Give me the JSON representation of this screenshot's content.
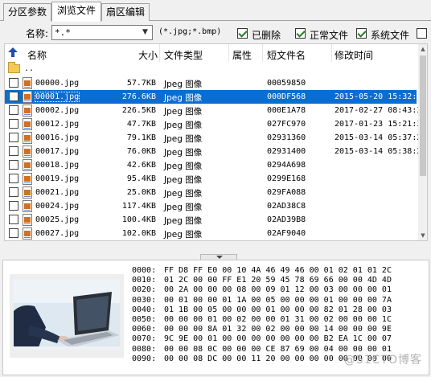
{
  "tabs": [
    "分区参数",
    "浏览文件",
    "扇区编辑"
  ],
  "filter": {
    "name_label": "名称:",
    "name_value": "*.*",
    "hint": "(*.jpg;*.bmp)",
    "checkboxes": [
      {
        "label": "已删除",
        "checked": true
      },
      {
        "label": "正常文件",
        "checked": true
      },
      {
        "label": "系统文件",
        "checked": true
      }
    ]
  },
  "list": {
    "columns": [
      "名称",
      "大小",
      "文件类型",
      "属性",
      "短文件名",
      "修改时间"
    ],
    "parent_label": "..",
    "rows": [
      {
        "name": "00000.jpg",
        "size": "57.7KB",
        "type": "Jpeg 图像",
        "attr": "",
        "short": "00059850",
        "mtime": "",
        "selected": false
      },
      {
        "name": "00001.jpg",
        "size": "276.6KB",
        "type": "Jpeg 图像",
        "attr": "",
        "short": "000DF568",
        "mtime": "2015-05-20 15:32:3",
        "selected": true
      },
      {
        "name": "00002.jpg",
        "size": "226.5KB",
        "type": "Jpeg 图像",
        "attr": "",
        "short": "000E1A78",
        "mtime": "2017-02-27 08:43:3",
        "selected": false
      },
      {
        "name": "00012.jpg",
        "size": "47.7KB",
        "type": "Jpeg 图像",
        "attr": "",
        "short": "027FC970",
        "mtime": "2017-01-23 15:21:3",
        "selected": false
      },
      {
        "name": "00016.jpg",
        "size": "79.1KB",
        "type": "Jpeg 图像",
        "attr": "",
        "short": "02931360",
        "mtime": "2015-03-14 05:37:2",
        "selected": false
      },
      {
        "name": "00017.jpg",
        "size": "76.0KB",
        "type": "Jpeg 图像",
        "attr": "",
        "short": "02931400",
        "mtime": "2015-03-14 05:38:2",
        "selected": false
      },
      {
        "name": "00018.jpg",
        "size": "42.6KB",
        "type": "Jpeg 图像",
        "attr": "",
        "short": "0294A698",
        "mtime": "",
        "selected": false
      },
      {
        "name": "00019.jpg",
        "size": "95.4KB",
        "type": "Jpeg 图像",
        "attr": "",
        "short": "0299E168",
        "mtime": "",
        "selected": false
      },
      {
        "name": "00021.jpg",
        "size": "25.0KB",
        "type": "Jpeg 图像",
        "attr": "",
        "short": "029FA088",
        "mtime": "",
        "selected": false
      },
      {
        "name": "00024.jpg",
        "size": "117.4KB",
        "type": "Jpeg 图像",
        "attr": "",
        "short": "02AD38C8",
        "mtime": "",
        "selected": false
      },
      {
        "name": "00025.jpg",
        "size": "100.4KB",
        "type": "Jpeg 图像",
        "attr": "",
        "short": "02AD39B8",
        "mtime": "",
        "selected": false
      },
      {
        "name": "00027.jpg",
        "size": "102.0KB",
        "type": "Jpeg 图像",
        "attr": "",
        "short": "02AF9040",
        "mtime": "",
        "selected": false
      }
    ]
  },
  "hex": [
    {
      "offset": "0000:",
      "bytes": "FF D8 FF E0 00 10 4A 46 49 46 00 01 02 01 01 2C"
    },
    {
      "offset": "0010:",
      "bytes": "01 2C 00 00 FF E1 20 59 45 78 69 66 00 00 4D 4D"
    },
    {
      "offset": "0020:",
      "bytes": "00 2A 00 00 00 08 00 09 01 12 00 03 00 00 00 01"
    },
    {
      "offset": "0030:",
      "bytes": "00 01 00 00 01 1A 00 05 00 00 00 01 00 00 00 7A"
    },
    {
      "offset": "0040:",
      "bytes": "01 1B 00 05 00 00 00 01 00 00 00 82 01 28 00 03"
    },
    {
      "offset": "0050:",
      "bytes": "00 00 00 01 00 02 00 00 01 31 00 02 00 00 00 1C"
    },
    {
      "offset": "0060:",
      "bytes": "00 00 00 8A 01 32 00 02 00 00 00 14 00 00 00 9E"
    },
    {
      "offset": "0070:",
      "bytes": "9C 9E 00 01 00 00 00 00 00 00 00 B2 EA 1C 00 07"
    },
    {
      "offset": "0080:",
      "bytes": "00 00 08 0C 00 00 00 CE 87 69 00 04 00 00 00 01"
    },
    {
      "offset": "0090:",
      "bytes": "00 00 08 DC 00 00 11 20 00 00 00 00 00 00 00 00"
    }
  ],
  "watermark": "@51CTO博客"
}
